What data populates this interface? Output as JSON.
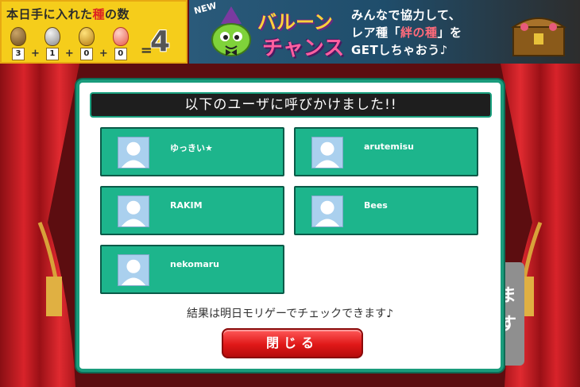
{
  "seed_panel": {
    "title_pre": "本日手に入れた",
    "title_rare": "種",
    "title_post": "の数",
    "seeds": [
      {
        "icon": "brown-seed-icon",
        "count": "3"
      },
      {
        "icon": "silver-seed-icon",
        "count": "1"
      },
      {
        "icon": "gold-seed-icon",
        "count": "0"
      },
      {
        "icon": "peach-seed-icon",
        "count": "0"
      }
    ],
    "plus": "+",
    "equals": "=",
    "total": "4"
  },
  "banner": {
    "new_label": "NEW",
    "title_line1": "バルーン",
    "title_line2": "チャンス",
    "text_line1": "みんなで協力して、",
    "text_line2_pre": "レア種「",
    "text_line2_hl": "絆の種",
    "text_line2_post": "」を",
    "text_line3": "GETしちゃおう♪"
  },
  "dialog": {
    "title": "以下のユーザに呼びかけました!!",
    "users": [
      {
        "name": "ゆっきい★"
      },
      {
        "name": "arutemisu"
      },
      {
        "name": "RAKIM"
      },
      {
        "name": "Bees"
      },
      {
        "name": "nekomaru"
      }
    ],
    "result_text": "結果は明日モリゲーでチェックできます♪",
    "close_label": "閉じる"
  },
  "background_button": {
    "line1": "ま",
    "line2": "す"
  },
  "colors": {
    "accent_green": "#1db58c",
    "dialog_border": "#1a9c7c",
    "close_red": "#e01818",
    "panel_yellow": "#f5cd1b"
  }
}
